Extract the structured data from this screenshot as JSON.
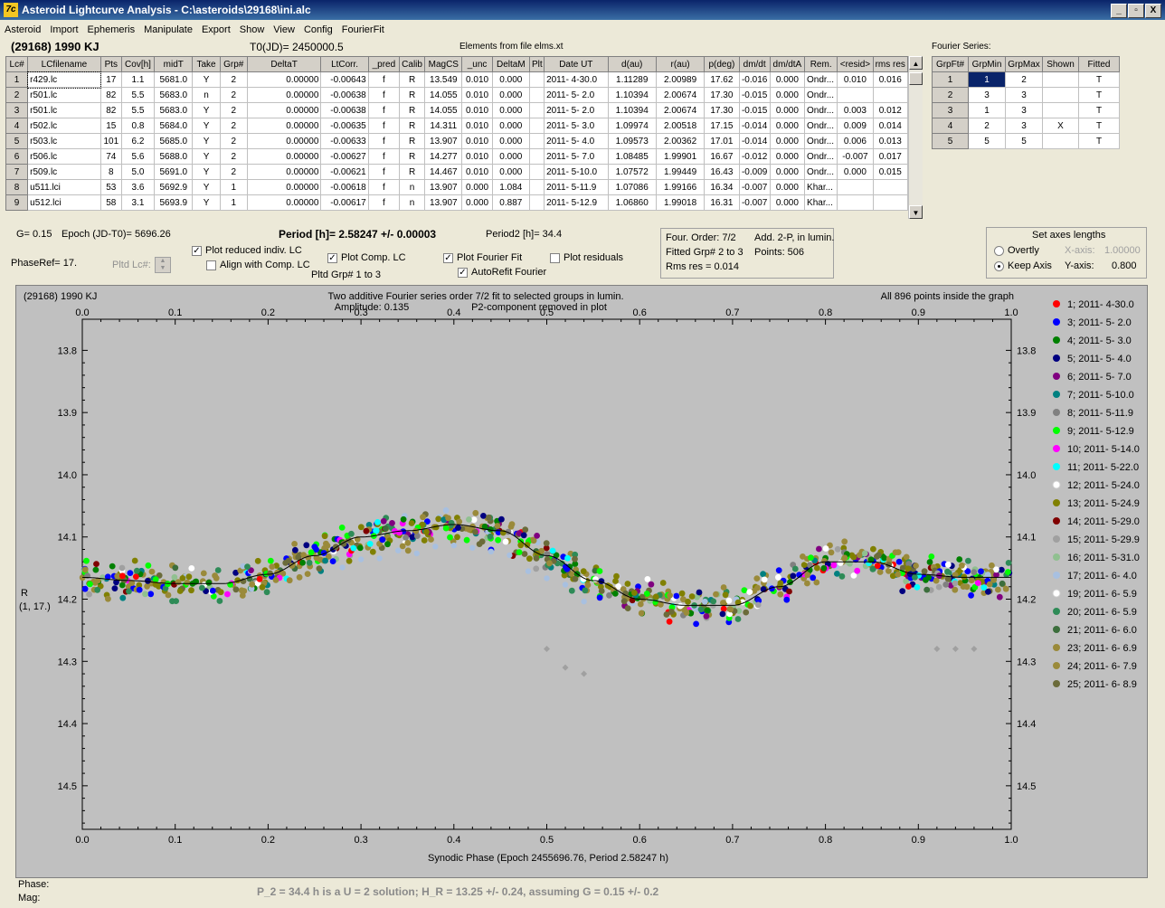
{
  "window": {
    "title": "Asteroid Lightcurve Analysis - C:\\asteroids\\29168\\ini.alc",
    "buttons": [
      "_",
      "▫",
      "X"
    ]
  },
  "menu": [
    "Asteroid",
    "Import",
    "Ephemeris",
    "Manipulate",
    "Export",
    "Show",
    "View",
    "Config",
    "FourierFit"
  ],
  "header": {
    "asteroid": "(29168) 1990 KJ",
    "t0": "T0(JD)= 2450000.5",
    "elements": "Elements from file elms.xt",
    "fourier_label": "Fourier Series:"
  },
  "lc_table": {
    "columns": [
      "Lc#",
      "LCfilename",
      "Pts",
      "Cov[h]",
      "midT",
      "Take",
      "Grp#",
      "DeltaT",
      "LtCorr.",
      "_pred",
      "Calib",
      "MagCS",
      "_unc",
      "DeltaM",
      "Plt",
      "Date UT",
      "d(au)",
      "r(au)",
      "p(deg)",
      "dm/dt",
      "dm/dtA",
      "Rem.",
      "<resid>",
      "rms res"
    ],
    "rows": [
      [
        "1",
        "r429.lc",
        "17",
        "1.1",
        "5681.0",
        "Y",
        "2",
        "0.00000",
        "-0.00643",
        "f",
        "R",
        "13.549",
        "0.010",
        "0.000",
        "",
        "2011- 4-30.0",
        "1.11289",
        "2.00989",
        "17.62",
        "-0.016",
        "0.000",
        "Ondr...",
        "0.010",
        "0.016"
      ],
      [
        "2",
        "r501.lc",
        "82",
        "5.5",
        "5683.0",
        "n",
        "2",
        "0.00000",
        "-0.00638",
        "f",
        "R",
        "14.055",
        "0.010",
        "0.000",
        "",
        "2011- 5- 2.0",
        "1.10394",
        "2.00674",
        "17.30",
        "-0.015",
        "0.000",
        "Ondr...",
        "",
        ""
      ],
      [
        "3",
        "r501.lc",
        "82",
        "5.5",
        "5683.0",
        "Y",
        "2",
        "0.00000",
        "-0.00638",
        "f",
        "R",
        "14.055",
        "0.010",
        "0.000",
        "",
        "2011- 5- 2.0",
        "1.10394",
        "2.00674",
        "17.30",
        "-0.015",
        "0.000",
        "Ondr...",
        "0.003",
        "0.012"
      ],
      [
        "4",
        "r502.lc",
        "15",
        "0.8",
        "5684.0",
        "Y",
        "2",
        "0.00000",
        "-0.00635",
        "f",
        "R",
        "14.311",
        "0.010",
        "0.000",
        "",
        "2011- 5- 3.0",
        "1.09974",
        "2.00518",
        "17.15",
        "-0.014",
        "0.000",
        "Ondr...",
        "0.009",
        "0.014"
      ],
      [
        "5",
        "r503.lc",
        "101",
        "6.2",
        "5685.0",
        "Y",
        "2",
        "0.00000",
        "-0.00633",
        "f",
        "R",
        "13.907",
        "0.010",
        "0.000",
        "",
        "2011- 5- 4.0",
        "1.09573",
        "2.00362",
        "17.01",
        "-0.014",
        "0.000",
        "Ondr...",
        "0.006",
        "0.013"
      ],
      [
        "6",
        "r506.lc",
        "74",
        "5.6",
        "5688.0",
        "Y",
        "2",
        "0.00000",
        "-0.00627",
        "f",
        "R",
        "14.277",
        "0.010",
        "0.000",
        "",
        "2011- 5- 7.0",
        "1.08485",
        "1.99901",
        "16.67",
        "-0.012",
        "0.000",
        "Ondr...",
        "-0.007",
        "0.017"
      ],
      [
        "7",
        "r509.lc",
        "8",
        "5.0",
        "5691.0",
        "Y",
        "2",
        "0.00000",
        "-0.00621",
        "f",
        "R",
        "14.467",
        "0.010",
        "0.000",
        "",
        "2011- 5-10.0",
        "1.07572",
        "1.99449",
        "16.43",
        "-0.009",
        "0.000",
        "Ondr...",
        "0.000",
        "0.015"
      ],
      [
        "8",
        "u511.lci",
        "53",
        "3.6",
        "5692.9",
        "Y",
        "1",
        "0.00000",
        "-0.00618",
        "f",
        "n",
        "13.907",
        "0.000",
        "1.084",
        "",
        "2011- 5-11.9",
        "1.07086",
        "1.99166",
        "16.34",
        "-0.007",
        "0.000",
        "Khar...",
        "",
        ""
      ],
      [
        "9",
        "u512.lci",
        "58",
        "3.1",
        "5693.9",
        "Y",
        "1",
        "0.00000",
        "-0.00617",
        "f",
        "n",
        "13.907",
        "0.000",
        "0.887",
        "",
        "2011- 5-12.9",
        "1.06860",
        "1.99018",
        "16.31",
        "-0.007",
        "0.000",
        "Khar...",
        "",
        ""
      ]
    ]
  },
  "fourier_table": {
    "columns": [
      "GrpFt#",
      "GrpMin",
      "GrpMax",
      "Shown",
      "Fitted"
    ],
    "rows": [
      [
        "1",
        "1",
        "2",
        "",
        "T"
      ],
      [
        "2",
        "3",
        "3",
        "",
        "T"
      ],
      [
        "3",
        "1",
        "3",
        "",
        "T"
      ],
      [
        "4",
        "2",
        "3",
        "X",
        "T"
      ],
      [
        "5",
        "5",
        "5",
        "",
        "T"
      ]
    ]
  },
  "params": {
    "g": "G= 0.15",
    "epoch": "Epoch (JD-T0)= 5696.26",
    "phaseref": "PhaseRef= 17.",
    "pltd_lc": "Pltd Lc#:",
    "period": "Period [h]= 2.58247 +/- 0.00003",
    "period2": "Period2 [h]= 34.4",
    "pltd_grp": "Pltd Grp#  1  to   3"
  },
  "checkboxes": {
    "plot_reduced": {
      "label": "Plot reduced indiv. LC",
      "checked": "✓"
    },
    "align_comp": {
      "label": "Align with Comp. LC",
      "checked": ""
    },
    "plot_comp": {
      "label": "Plot Comp. LC",
      "checked": "✓"
    },
    "plot_fourier": {
      "label": "Plot Fourier Fit",
      "checked": "✓"
    },
    "autorefit": {
      "label": "AutoRefit Fourier",
      "checked": "✓"
    },
    "plot_resid": {
      "label": "Plot residuals",
      "checked": ""
    }
  },
  "fitinfo": {
    "line1a": "Four. Order:  7/2",
    "line1b": "Add. 2-P, in lumin.",
    "line2a": "Fitted Grp# 2 to 3",
    "line2b": "Points: 506",
    "line3": "Rms res    = 0.014"
  },
  "axes_box": {
    "title": "Set axes lengths",
    "overall": "Overtly",
    "keep": "Keep Axis",
    "xaxis_label": "X-axis:",
    "xaxis_val": "1.00000",
    "yaxis_label": "Y-axis:",
    "yaxis_val": "0.800"
  },
  "plot": {
    "top_left": "(29168) 1990 KJ",
    "title1": "Two additive Fourier series order 7/2 fit to selected groups in lumin.",
    "amplitude": "Amplitude: 0.135",
    "p2note": "P2-component removed in plot",
    "points_note": "All 896 points inside the graph",
    "ylabel1": "R",
    "ylabel2": "(1, 17.)",
    "xlabel": "Synodic Phase (Epoch 2455696.76, Period 2.58247 h)",
    "xticks": [
      "0.0",
      "0.1",
      "0.2",
      "0.3",
      "0.4",
      "0.5",
      "0.6",
      "0.7",
      "0.8",
      "0.9",
      "1.0"
    ],
    "yticks": [
      "13.8",
      "13.9",
      "14.0",
      "14.1",
      "14.2",
      "14.3",
      "14.4",
      "14.5"
    ]
  },
  "legend": [
    {
      "label": "1; 2011- 4-30.0",
      "color": "#ff0000"
    },
    {
      "label": "3; 2011- 5- 2.0",
      "color": "#0000ff"
    },
    {
      "label": "4; 2011- 5- 3.0",
      "color": "#008000"
    },
    {
      "label": "5; 2011- 5- 4.0",
      "color": "#000080"
    },
    {
      "label": "6; 2011- 5- 7.0",
      "color": "#800080"
    },
    {
      "label": "7; 2011- 5-10.0",
      "color": "#008080"
    },
    {
      "label": "8; 2011- 5-11.9",
      "color": "#808080"
    },
    {
      "label": "9; 2011- 5-12.9",
      "color": "#00ff00"
    },
    {
      "label": "10; 2011- 5-14.0",
      "color": "#ff00ff"
    },
    {
      "label": "11; 2011- 5-22.0",
      "color": "#00ffff"
    },
    {
      "label": "12; 2011- 5-24.0",
      "color": "#ffffff"
    },
    {
      "label": "13; 2011- 5-24.9",
      "color": "#808000"
    },
    {
      "label": "14; 2011- 5-29.0",
      "color": "#800000"
    },
    {
      "label": "15; 2011- 5-29.9",
      "color": "#a0a0a0"
    },
    {
      "label": "16; 2011- 5-31.0",
      "color": "#90c090"
    },
    {
      "label": "17; 2011- 6- 4.0",
      "color": "#a8c0e0"
    },
    {
      "label": "19; 2011- 6- 5.9",
      "color": "#ffffff"
    },
    {
      "label": "20; 2011- 6- 5.9",
      "color": "#2e8b57"
    },
    {
      "label": "21; 2011- 6- 6.0",
      "color": "#3c6e3c"
    },
    {
      "label": "23; 2011- 6- 6.9",
      "color": "#9a8a3a"
    },
    {
      "label": "24; 2011- 6- 7.9",
      "color": "#9a8a3a"
    },
    {
      "label": "25; 2011- 6- 8.9",
      "color": "#6b6b3a"
    }
  ],
  "status": {
    "phase": "Phase:",
    "mag": "Mag:",
    "note": "P_2 = 34.4 h is a U = 2 solution; H_R = 13.25 +/- 0.24, assuming G = 0.15 +/- 0.2"
  },
  "chart_data": {
    "type": "scatter",
    "xlabel": "Synodic Phase (Epoch 2455696.76, Period 2.58247 h)",
    "ylabel": "R (1, 17.)",
    "xlim": [
      0.0,
      1.0
    ],
    "ylim": [
      13.75,
      14.57
    ],
    "y_inverted": true,
    "fourier_curve": {
      "x": [
        0.0,
        0.05,
        0.1,
        0.15,
        0.2,
        0.25,
        0.3,
        0.35,
        0.4,
        0.45,
        0.5,
        0.55,
        0.6,
        0.65,
        0.7,
        0.75,
        0.8,
        0.85,
        0.9,
        0.95,
        1.0
      ],
      "y": [
        14.165,
        14.17,
        14.175,
        14.175,
        14.16,
        14.13,
        14.1,
        14.09,
        14.08,
        14.09,
        14.13,
        14.17,
        14.2,
        14.21,
        14.21,
        14.18,
        14.14,
        14.14,
        14.16,
        14.165,
        14.165
      ]
    },
    "outliers": {
      "x": [
        0.5,
        0.52,
        0.54,
        0.92,
        0.94,
        0.96
      ],
      "y": [
        14.28,
        14.31,
        14.32,
        14.28,
        14.28,
        14.28
      ]
    }
  }
}
